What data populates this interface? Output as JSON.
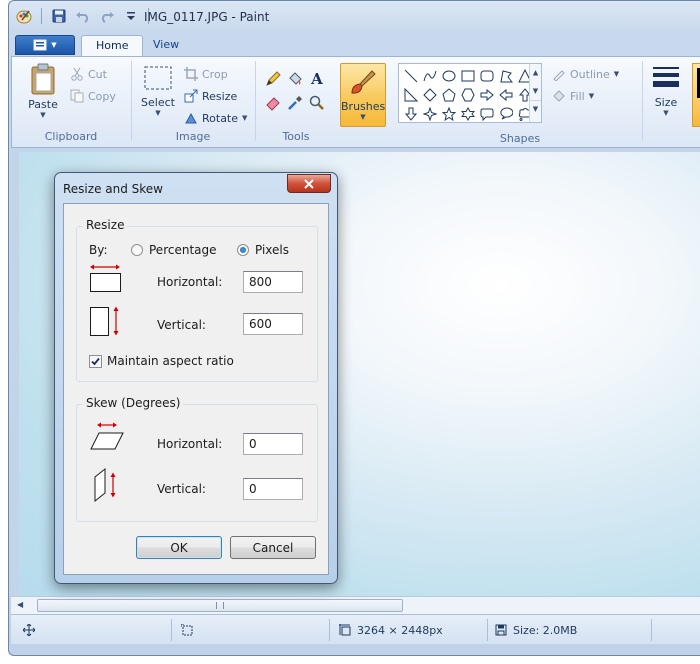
{
  "window": {
    "title": "IMG_0117.JPG - Paint"
  },
  "tabs": [
    {
      "label": "Home",
      "active": true
    },
    {
      "label": "View",
      "active": false
    }
  ],
  "ribbon": {
    "clipboard": {
      "label": "Clipboard",
      "paste": "Paste",
      "cut": "Cut",
      "copy": "Copy"
    },
    "image": {
      "label": "Image",
      "select": "Select",
      "crop": "Crop",
      "resize": "Resize",
      "rotate": "Rotate"
    },
    "tools": {
      "label": "Tools"
    },
    "brushes": {
      "label": "Brushes"
    },
    "shapes": {
      "label": "Shapes",
      "outline": "Outline",
      "fill": "Fill"
    },
    "size": {
      "label": "Size"
    }
  },
  "status": {
    "dimensions": "3264 × 2448px",
    "size": "Size: 2.0MB"
  },
  "dialog": {
    "title": "Resize and Skew",
    "resize": {
      "legend": "Resize",
      "by_label": "By:",
      "percentage_label": "Percentage",
      "pixels_label": "Pixels",
      "selected": "Pixels",
      "horizontal_label": "Horizontal:",
      "horizontal_value": "800",
      "vertical_label": "Vertical:",
      "vertical_value": "600",
      "maintain_label": "Maintain aspect ratio",
      "maintain_checked": true
    },
    "skew": {
      "legend": "Skew (Degrees)",
      "horizontal_label": "Horizontal:",
      "horizontal_value": "0",
      "vertical_label": "Vertical:",
      "vertical_value": "0"
    },
    "ok_label": "OK",
    "cancel_label": "Cancel"
  },
  "colors": {
    "accent": "#1b55a8",
    "brushes_active": "#f8c95c",
    "close_button": "#d0533a",
    "resize_arrows": "#d00000"
  },
  "icons": [
    "paint-app-icon",
    "save-icon",
    "undo-icon",
    "redo-icon",
    "customize-qat-icon",
    "close-icon"
  ]
}
